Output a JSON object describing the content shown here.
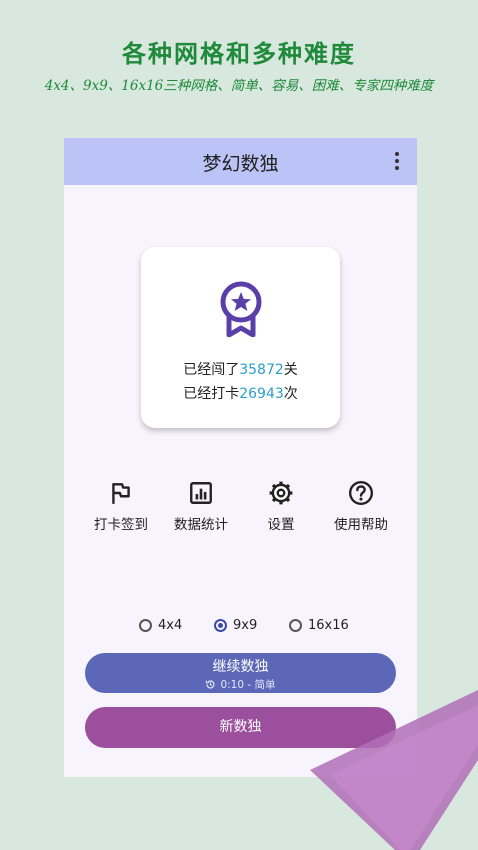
{
  "promo": {
    "title": "各种网格和多种难度",
    "subtitle": "4x4、9x9、16x16三种网格、简单、容易、困难、专家四种难度"
  },
  "app": {
    "title": "梦幻数独",
    "stats": {
      "levels_prefix": "已经闯了",
      "levels_value": "35872",
      "levels_suffix": "关",
      "checkin_prefix": "已经打卡",
      "checkin_value": "26943",
      "checkin_suffix": "次"
    },
    "actions": [
      {
        "label": "打卡签到",
        "icon": "flag-icon"
      },
      {
        "label": "数据统计",
        "icon": "bar-chart-icon"
      },
      {
        "label": "设置",
        "icon": "gear-icon"
      },
      {
        "label": "使用帮助",
        "icon": "help-icon"
      }
    ],
    "grid_options": [
      {
        "label": "4x4",
        "selected": false
      },
      {
        "label": "9x9",
        "selected": true
      },
      {
        "label": "16x16",
        "selected": false
      }
    ],
    "continue_button": {
      "label": "继续数独",
      "meta": "0:10 - 简单"
    },
    "new_button": {
      "label": "新数独"
    }
  },
  "colors": {
    "background": "#d8e8df",
    "promo_text": "#1e8a3a",
    "appbar": "#bcc3f7",
    "accent_purple": "#5b3fa8",
    "stat_number": "#2aa0c8",
    "continue_button": "#5c67b8",
    "new_button": "#9b4f9c"
  }
}
